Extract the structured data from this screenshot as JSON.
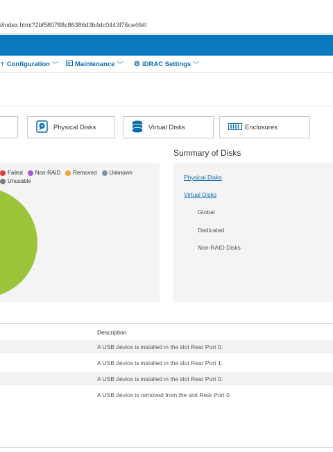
{
  "browser": {
    "url": "i/index.html?2bf580788c86386d3b4dc0443f76ce46#/"
  },
  "menu": {
    "configuration": "Configuration",
    "maintenance": "Maintenance",
    "idrac_settings": "iDRAC Settings"
  },
  "tabs": [
    {
      "label": "Physical Disks",
      "icon": "physical-disk-icon"
    },
    {
      "label": "Virtual Disks",
      "icon": "database-icon"
    },
    {
      "label": "Enclosures",
      "icon": "enclosure-icon"
    }
  ],
  "legend": [
    {
      "label": "Failed",
      "color": "#e03a3a"
    },
    {
      "label": "Non-RAID",
      "color": "#a957d4"
    },
    {
      "label": "Removed",
      "color": "#f0a33a"
    },
    {
      "label": "Unknown",
      "color": "#7c93a6"
    },
    {
      "label": "Unusable",
      "color": "#7a7a7a"
    }
  ],
  "chart": {
    "main_slice_color": "#9cc43b"
  },
  "summary": {
    "title": "Summary of Disks",
    "physical_disks": "Physical Disks",
    "virtual_disks": "Virtual Disks",
    "global": "Global",
    "dedicated": "Dedicated",
    "non_raid": "Non-RAID Disks"
  },
  "log": {
    "description_header": "Description",
    "rows": [
      "A USB device is installed in the slot Rear Port 0.",
      "A USB device is installed in the slot Rear Port 1.",
      "A USB device is installed in the slot Rear Port 0.",
      "A USB device is removed from the slot Rear Port 0."
    ]
  }
}
